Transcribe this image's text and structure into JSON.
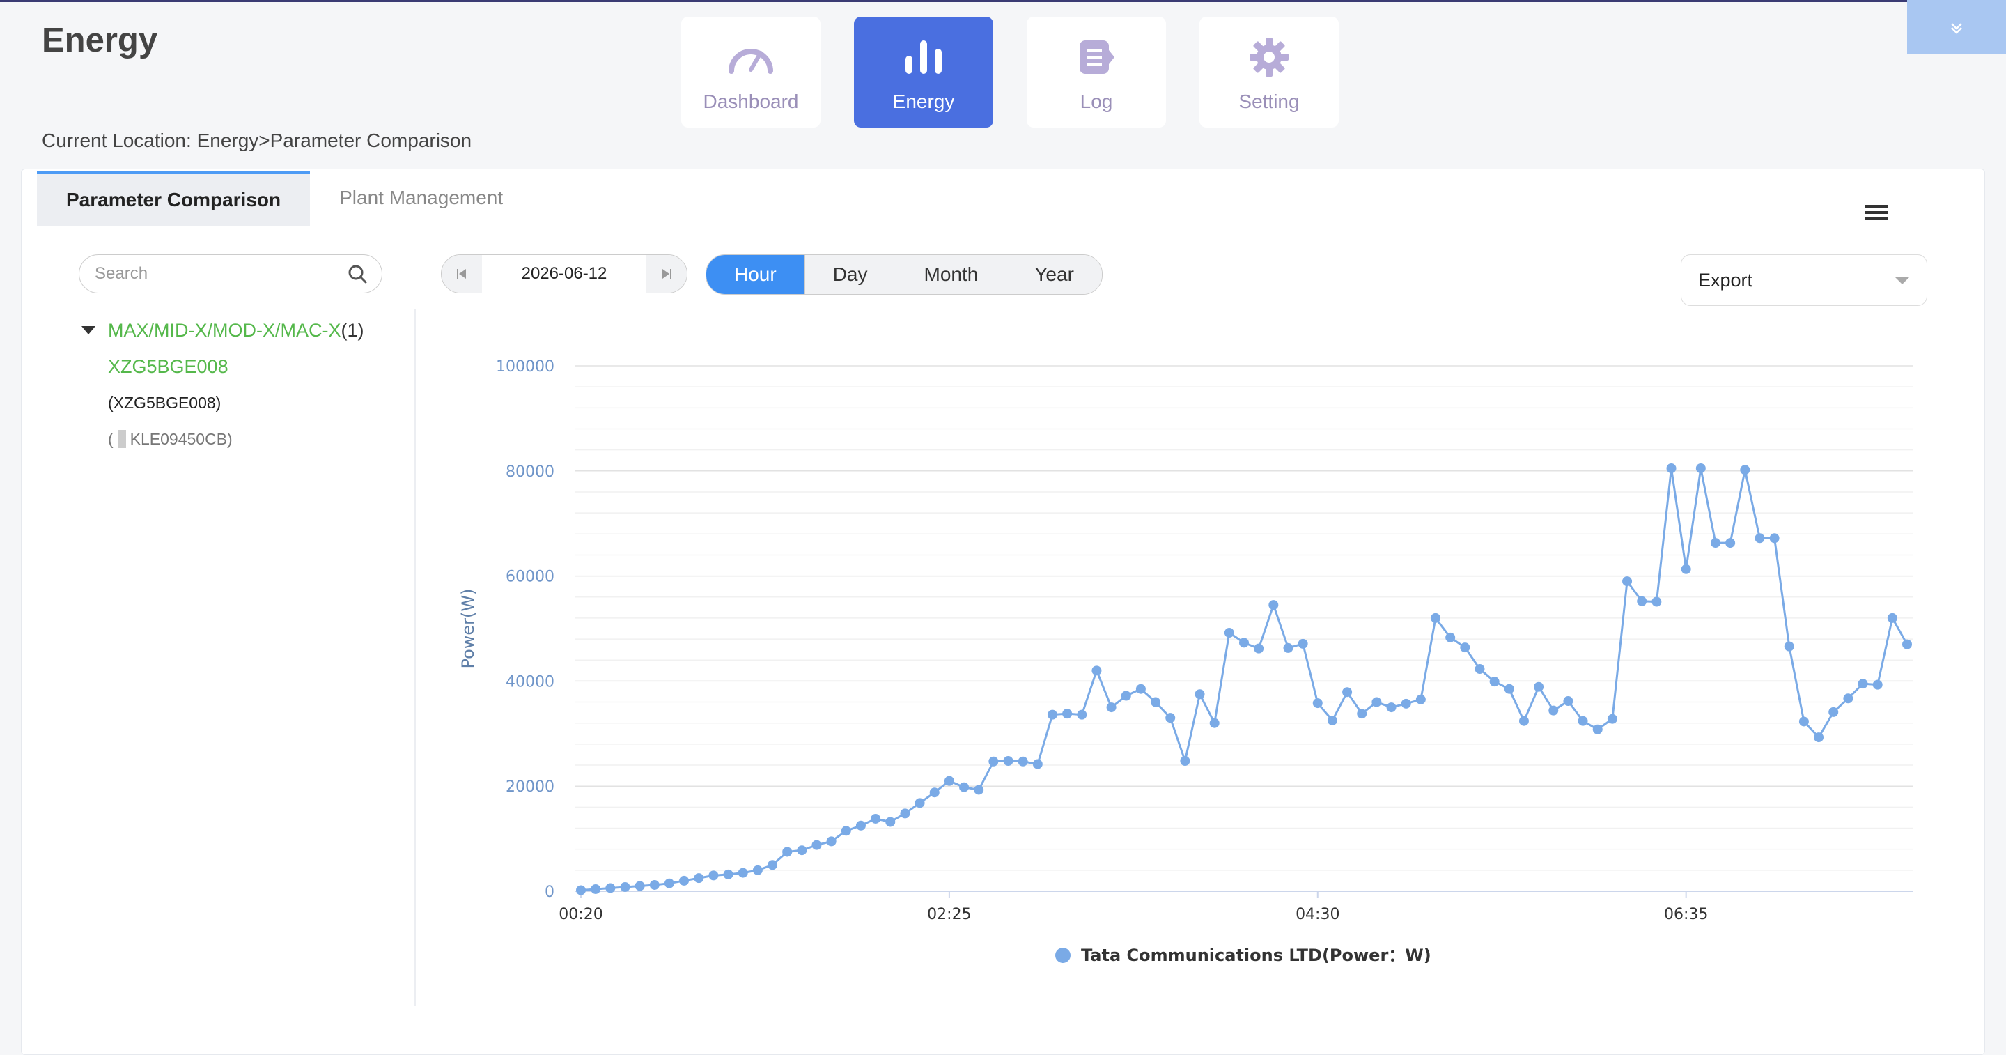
{
  "page": {
    "title": "Energy",
    "breadcrumb": "Current Location: Energy>Parameter Comparison"
  },
  "nav": [
    {
      "label": "Dashboard",
      "icon": "speedometer-icon"
    },
    {
      "label": "Energy",
      "icon": "bar-chart-icon",
      "active": true
    },
    {
      "label": "Log",
      "icon": "log-list-icon"
    },
    {
      "label": "Setting",
      "icon": "gear-icon"
    }
  ],
  "tabs": [
    {
      "label": "Parameter Comparison",
      "active": true
    },
    {
      "label": "Plant Management"
    }
  ],
  "search": {
    "placeholder": "Search"
  },
  "tree": {
    "group_label": "MAX/MID-X/MOD-X/MAC-X",
    "group_count": "(1)",
    "device": "XZG5BGE008",
    "sub1": "(XZG5BGE008)",
    "sub2_open": "(",
    "sub2_text": "KLE09450CB)"
  },
  "date": {
    "value": "2026-06-12"
  },
  "period": {
    "options": [
      "Hour",
      "Day",
      "Month",
      "Year"
    ],
    "selected": "Hour"
  },
  "export": {
    "label": "Export"
  },
  "colors": {
    "accent": "#4a6fe0",
    "series": "#7aaae6",
    "green": "#55b84b",
    "toggle_active": "#3d8ff3"
  },
  "chart_data": {
    "type": "line",
    "ylabel": "Power(W)",
    "ylim": [
      0,
      100000
    ],
    "yticks": [
      0,
      20000,
      40000,
      60000,
      80000,
      100000
    ],
    "xtick_labels": [
      "00:20",
      "02:25",
      "04:30",
      "06:35"
    ],
    "xtick_indices": [
      0,
      25,
      50,
      75
    ],
    "grid": true,
    "legend_position": "bottom-center",
    "series": [
      {
        "name": "Tata Communications LTD(Power：W)",
        "values": [
          200,
          400,
          600,
          800,
          1000,
          1200,
          1500,
          2000,
          2500,
          3000,
          3200,
          3500,
          4000,
          5000,
          7500,
          7800,
          8800,
          9500,
          11500,
          12500,
          13800,
          13200,
          14800,
          16800,
          18800,
          21000,
          19800,
          19300,
          24700,
          24800,
          24700,
          24200,
          33600,
          33800,
          33600,
          42000,
          35000,
          37200,
          38500,
          36000,
          33000,
          24800,
          37500,
          32000,
          49200,
          47300,
          46200,
          54500,
          46300,
          47100,
          35800,
          32500,
          37900,
          33800,
          36000,
          35000,
          35700,
          36500,
          52000,
          48300,
          46400,
          42300,
          39900,
          38500,
          32400,
          38900,
          34400,
          36200,
          32400,
          30800,
          32800,
          59000,
          55200,
          55100,
          80500,
          61300,
          80500,
          66300,
          66300,
          80200,
          67200,
          67200,
          46600,
          32300,
          29300,
          34100,
          36700,
          39500,
          39300,
          52000,
          47000
        ]
      }
    ]
  }
}
